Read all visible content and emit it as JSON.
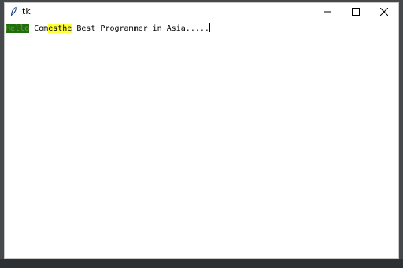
{
  "window": {
    "title": "tk",
    "icon": "feather-icon",
    "controls": {
      "minimize": "minimize-icon",
      "maximize": "maximize-icon",
      "close": "close-icon"
    }
  },
  "text": {
    "segment_1": "Hello",
    "segment_2": " Com",
    "segment_3": "esthe",
    "segment_4": " Best Programmer in Asia.....",
    "colors": {
      "green_highlight": "#1f6e0c",
      "yellow_highlight": "#ffff33"
    }
  }
}
